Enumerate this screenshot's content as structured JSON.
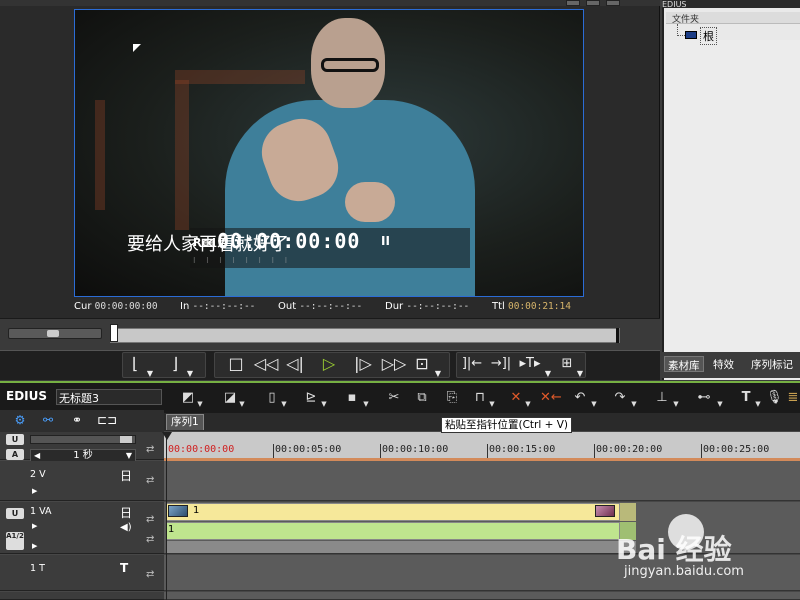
{
  "preview": {
    "subtitle": "要给人家再看就好了",
    "rec_label": "Rcd",
    "rec_timecode": "00:00:00:00",
    "rec_state_glyph": "II",
    "rec_dots": "⁝  ⁝  ⁝  ⁝  ⁝  ⁝  ⁝  ⁝",
    "timecodes": [
      {
        "label": "Cur",
        "value": "00:00:00:00"
      },
      {
        "label": "In",
        "value": "--:--:--:--"
      },
      {
        "label": "Out",
        "value": "--:--:--:--"
      },
      {
        "label": "Dur",
        "value": "--:--:--:--"
      },
      {
        "label": "Ttl",
        "value": "00:00:21:14"
      }
    ]
  },
  "transport": {
    "set_in_icon": "mark-in-icon",
    "set_out_icon": "mark-out-icon",
    "stop_glyph": "□",
    "rewind_glyph": "◁◁",
    "step_back_glyph": "◁|",
    "play_glyph": "▷",
    "step_fwd_glyph": "|▷",
    "ffwd_glyph": "▷▷",
    "loop_glyph": "⊐",
    "play_color": "#9acd32"
  },
  "right_panel": {
    "top_title": "EDIUS",
    "folder_header": "文件夹",
    "root_folder": "根",
    "tabs": [
      "素材库",
      "特效",
      "序列标记"
    ]
  },
  "timeline": {
    "app_name": "EDIUS",
    "project_name": "无标题3",
    "sequence_tab": "序列1",
    "tooltip": "粘贴至指针位置(Ctrl + V)",
    "zoom_value": "1 秒",
    "ruler_labels": [
      "00:00:00:00",
      "00:00:05:00",
      "00:00:10:00",
      "00:00:15:00",
      "00:00:20:00",
      "00:00:25:00"
    ],
    "tracks": [
      {
        "name": "2 V",
        "icon": "日"
      },
      {
        "name": "1 VA",
        "icon": "日",
        "audio_icon": "◀)"
      },
      {
        "name": "1 T",
        "icon": "T"
      }
    ],
    "side_buttons": {
      "lock": "U",
      "audio": "A",
      "a12": "A1/2"
    },
    "clip_video_label": "1",
    "clip_audio_label": "1"
  },
  "watermark": {
    "brand": "Bai 经验",
    "url": "jingyan.baidu.com"
  }
}
